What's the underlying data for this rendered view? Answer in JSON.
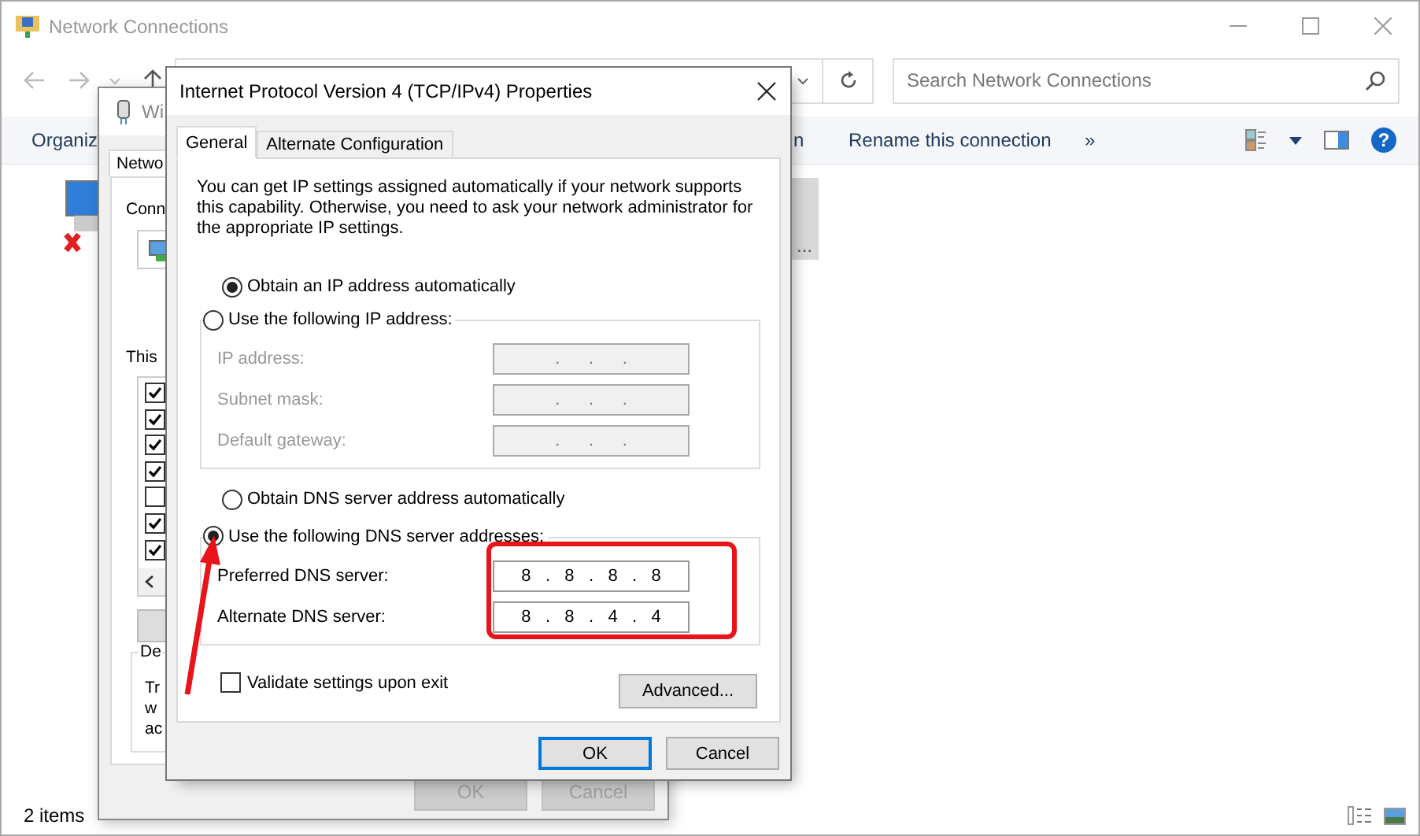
{
  "explorer": {
    "title": "Network Connections",
    "search": {
      "placeholder": "Search Network Connections"
    },
    "toolbar": [
      "Organiz",
      "n",
      "Rename this connection",
      "»"
    ],
    "help": "?",
    "item_label": "...",
    "status_bar": "2 items"
  },
  "back_dialog": {
    "title": "Wi",
    "tab": "Netwo",
    "connect_label": "Conn",
    "list_label": "This",
    "components": [
      {
        "checked": true
      },
      {
        "checked": true
      },
      {
        "checked": true
      },
      {
        "checked": true
      },
      {
        "checked": false
      },
      {
        "checked": true
      },
      {
        "checked": true
      }
    ],
    "description_title": "De",
    "description_lines": [
      "Tr",
      "w",
      "ac"
    ],
    "buttons": [
      {
        "label": "OK",
        "disabled": true
      },
      {
        "label": "Cancel",
        "disabled": true
      }
    ]
  },
  "ip_dialog": {
    "title": "Internet Protocol Version 4 (TCP/IPv4) Properties",
    "tabs": [
      {
        "label": "General",
        "selected": true
      },
      {
        "label": "Alternate Configuration",
        "selected": false
      }
    ],
    "intro": "You can get IP settings assigned automatically if your network supports this capability. Otherwise, you need to ask your network administrator for the appropriate IP settings.",
    "ip_options": [
      {
        "label": "Obtain an IP address automatically",
        "selected": true
      },
      {
        "label": "Use the following IP address:",
        "selected": false
      }
    ],
    "ip_fields": [
      {
        "label": "IP address:",
        "value": ".      .      .",
        "disabled": true
      },
      {
        "label": "Subnet mask:",
        "value": ".      .      .",
        "disabled": true
      },
      {
        "label": "Default gateway:",
        "value": ".      .      .",
        "disabled": true
      }
    ],
    "dns_options": [
      {
        "label": "Obtain DNS server address automatically",
        "selected": false
      },
      {
        "label": "Use the following DNS server addresses:",
        "selected": true
      }
    ],
    "dns_fields": [
      {
        "label": "Preferred DNS server:",
        "value": "8   .   8   .   8   .   8",
        "disabled": false
      },
      {
        "label": "Alternate DNS server:",
        "value": "8   .   8   .   4   .   4",
        "disabled": false
      }
    ],
    "validate": {
      "label": "Validate settings upon exit",
      "checked": false
    },
    "advanced_button": "Advanced...",
    "buttons": [
      {
        "label": "OK",
        "default": true
      },
      {
        "label": "Cancel",
        "default": false
      }
    ]
  }
}
